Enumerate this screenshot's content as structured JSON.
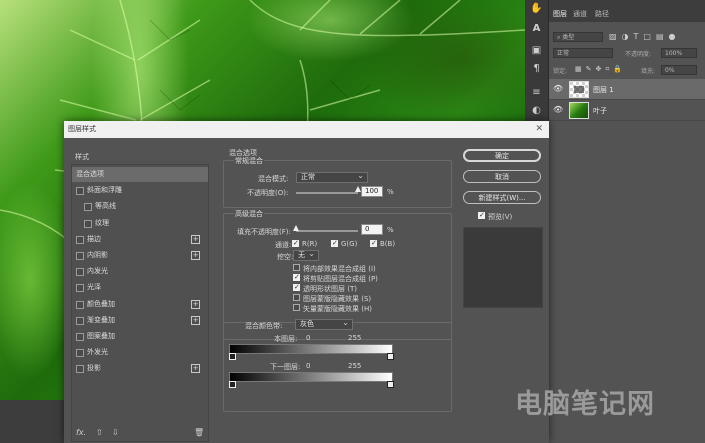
{
  "tools": [
    "hand-tool",
    "type-tool",
    "layers-tool",
    "paragraph-tool",
    "adjust-tool",
    "styles-tool"
  ],
  "layers_panel": {
    "tabs": [
      "图层",
      "通道",
      "路径"
    ],
    "filter_placeholder": "类型",
    "blend_mode": "正常",
    "opacity_label": "不透明度:",
    "opacity_value": "100%",
    "lock_label": "锁定:",
    "fill_label": "填充:",
    "fill_value": "0%",
    "layers": [
      {
        "name": "图层 1",
        "selected": true
      },
      {
        "name": "叶子",
        "selected": false
      }
    ]
  },
  "dialog": {
    "title": "图层样式",
    "styles_header": "样式",
    "style_items": [
      {
        "label": "混合选项",
        "has_checkbox": false,
        "has_plus": false,
        "selected": true,
        "indent": false
      },
      {
        "label": "斜面和浮雕",
        "has_checkbox": true,
        "has_plus": false,
        "selected": false,
        "indent": false
      },
      {
        "label": "等高线",
        "has_checkbox": true,
        "has_plus": false,
        "selected": false,
        "indent": true
      },
      {
        "label": "纹理",
        "has_checkbox": true,
        "has_plus": false,
        "selected": false,
        "indent": true
      },
      {
        "label": "描边",
        "has_checkbox": true,
        "has_plus": true,
        "selected": false,
        "indent": false
      },
      {
        "label": "内阴影",
        "has_checkbox": true,
        "has_plus": true,
        "selected": false,
        "indent": false
      },
      {
        "label": "内发光",
        "has_checkbox": true,
        "has_plus": false,
        "selected": false,
        "indent": false
      },
      {
        "label": "光泽",
        "has_checkbox": true,
        "has_plus": false,
        "selected": false,
        "indent": false
      },
      {
        "label": "颜色叠加",
        "has_checkbox": true,
        "has_plus": true,
        "selected": false,
        "indent": false
      },
      {
        "label": "渐变叠加",
        "has_checkbox": true,
        "has_plus": true,
        "selected": false,
        "indent": false
      },
      {
        "label": "图案叠加",
        "has_checkbox": true,
        "has_plus": false,
        "selected": false,
        "indent": false
      },
      {
        "label": "外发光",
        "has_checkbox": true,
        "has_plus": false,
        "selected": false,
        "indent": false
      },
      {
        "label": "投影",
        "has_checkbox": true,
        "has_plus": true,
        "selected": false,
        "indent": false
      }
    ],
    "fx_label": "fx.",
    "blend_options": {
      "section": "混合选项",
      "general": {
        "title": "常规混合",
        "mode_label": "混合模式:",
        "mode_value": "正常",
        "opacity_label": "不透明度(O):",
        "opacity_value": "100",
        "opacity_percent": 1.0,
        "unit": "%"
      },
      "advanced": {
        "title": "高级混合",
        "fill_label": "填充不透明度(F):",
        "fill_value": "0",
        "fill_percent": 0.0,
        "unit": "%",
        "channels_label": "通道:",
        "channels": [
          {
            "label": "R(R)",
            "checked": true
          },
          {
            "label": "G(G)",
            "checked": true
          },
          {
            "label": "B(B)",
            "checked": true
          }
        ],
        "knockout_label": "挖空:",
        "knockout_value": "无",
        "options": [
          {
            "label": "将内部效果混合成组 (I)",
            "checked": false
          },
          {
            "label": "将剪贴图层混合成组 (P)",
            "checked": true
          },
          {
            "label": "透明形状图层 (T)",
            "checked": true
          },
          {
            "label": "图层蒙版隐藏效果 (S)",
            "checked": false
          },
          {
            "label": "矢量蒙版隐藏效果 (H)",
            "checked": false
          }
        ]
      },
      "blend_if": {
        "label": "混合颜色带:",
        "value": "灰色",
        "this_layer_label": "本图层:",
        "this_layer_low": "0",
        "this_layer_high": "255",
        "underlying_label": "下一图层:",
        "underlying_low": "0",
        "underlying_high": "255"
      }
    },
    "buttons": {
      "ok": "确定",
      "cancel": "取消",
      "new_style": "新建样式(W)...",
      "preview_label": "预览(V)",
      "preview_checked": true
    }
  },
  "watermark": "电脑笔记网"
}
